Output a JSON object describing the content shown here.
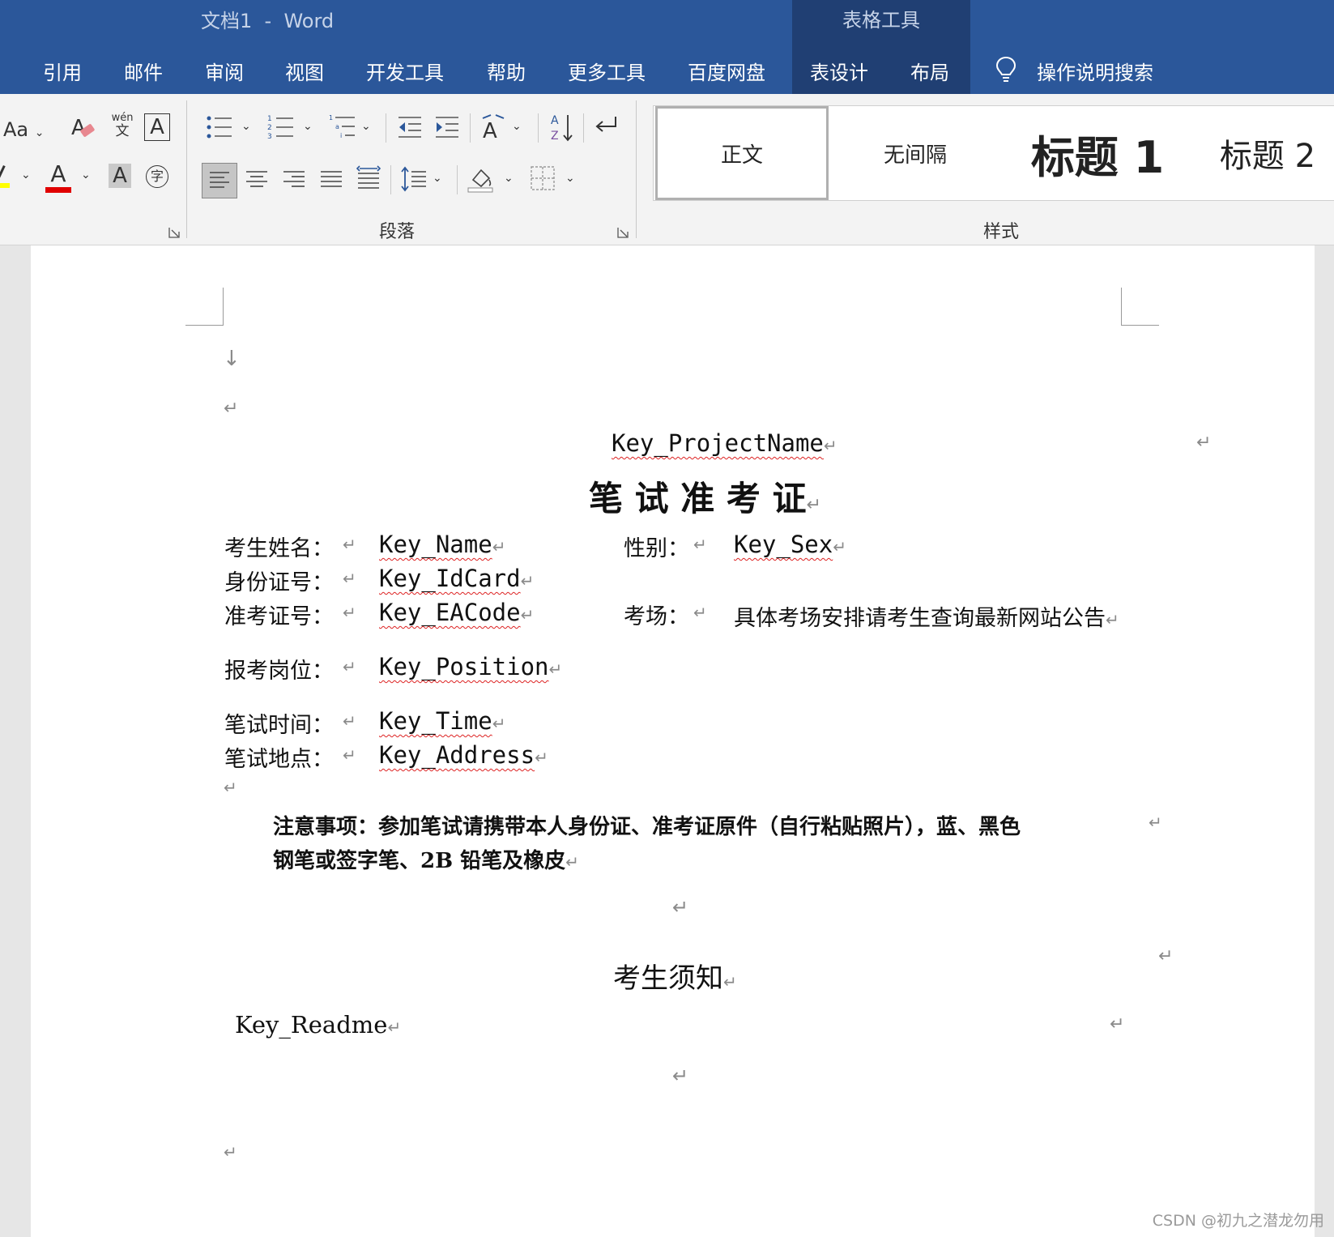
{
  "window": {
    "title": "文档1  -  Word",
    "context_label": "表格工具"
  },
  "tabs": [
    "引用",
    "邮件",
    "审阅",
    "视图",
    "开发工具",
    "帮助",
    "更多工具",
    "百度网盘",
    "表设计",
    "布局"
  ],
  "search": {
    "label": "操作说明搜索"
  },
  "ribbon": {
    "font_group": {
      "change_case_label": "Aa",
      "phonetic_top": "wén",
      "phonetic_bottom": "文",
      "char_border_label": "A",
      "font_color_label": "A",
      "char_shade_label": "A",
      "enclose_char_label": "字"
    },
    "paragraph_group": {
      "label": "段落"
    },
    "styles_group": {
      "label": "样式",
      "items": [
        "正文",
        "无间隔",
        "标题 1",
        "标题 2"
      ]
    },
    "colors": {
      "highlight": "#ffff00",
      "font_color": "#e00000"
    }
  },
  "document": {
    "project": "Key_ProjectName",
    "title": "笔 试 准 考 证",
    "fields": {
      "name_label": "考生姓名：",
      "name_value": "Key_Name",
      "sex_label": "性别：",
      "sex_value": "Key_Sex",
      "idcard_label": "身份证号：",
      "idcard_value": "Key_IdCard",
      "eacode_label": "准考证号：",
      "eacode_value": "Key_EACode",
      "room_label": "考场：",
      "room_value": "具体考场安排请考生查询最新网站公告",
      "position_label": "报考岗位：",
      "position_value": "Key_Position",
      "time_label": "笔试时间：",
      "time_value": "Key_Time",
      "address_label": "笔试地点：",
      "address_value": "Key_Address"
    },
    "notice_line1": "注意事项：参加笔试请携带本人身份证、准考证原件（自行粘贴照片），蓝、黑色",
    "notice_line2": "钢笔或签字笔、2B 铅笔及橡皮",
    "readme_title": "考生须知",
    "readme_value": "Key_Readme",
    "paragraph_mark": "↵",
    "line_break_mark": "↓"
  },
  "watermark": "CSDN @初九之潜龙勿用"
}
